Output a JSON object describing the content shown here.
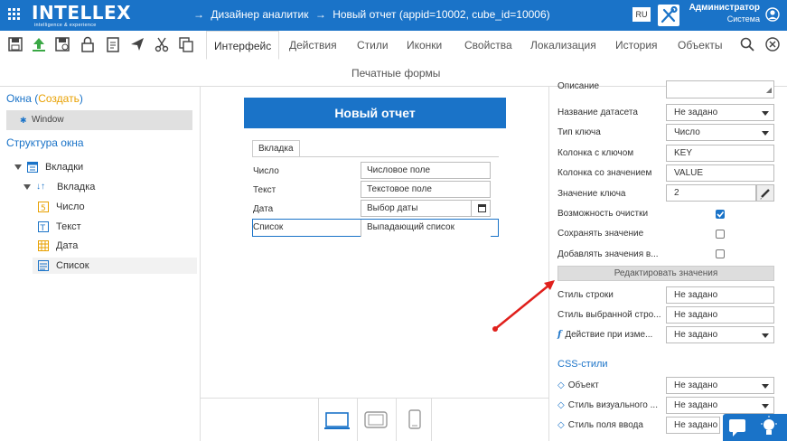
{
  "header": {
    "logo": "INTELLEX",
    "logo_sub": "intelligence & experience",
    "breadcrumb_prefix": "→",
    "breadcrumb_parent": "Дизайнер аналитик",
    "breadcrumb_sep": "→",
    "breadcrumb_current": "Новый отчет (appid=10002, cube_id=10006)",
    "lang": "RU",
    "user_name": "Администратор",
    "user_role": "Система"
  },
  "toolbar": {
    "tabs": [
      "Интерфейс",
      "Действия",
      "Стили",
      "Иконки",
      "Свойства",
      "Локализация",
      "История",
      "Объекты"
    ],
    "print_forms": "Печатные формы"
  },
  "left": {
    "windows_title": "Окна (",
    "create_label": "Создать",
    "windows_close": ")",
    "window_item": "Window",
    "structure_title": "Структура окна",
    "tree": [
      {
        "label": "Вкладки",
        "icon": "tabs-icon"
      },
      {
        "label": "Вкладка",
        "icon": "sort-arrows-icon"
      },
      {
        "label": "Число",
        "icon": "number-icon"
      },
      {
        "label": "Текст",
        "icon": "text-icon"
      },
      {
        "label": "Дата",
        "icon": "calendar-grid-icon"
      },
      {
        "label": "Список",
        "icon": "list-icon"
      }
    ]
  },
  "canvas": {
    "form_title": "Новый отчет",
    "tab_label": "Вкладка",
    "fields": [
      {
        "label": "Число",
        "value": "Числовое поле"
      },
      {
        "label": "Текст",
        "value": "Текстовое поле"
      },
      {
        "label": "Дата",
        "value": "Выбор даты"
      },
      {
        "label": "Список",
        "value": "Выпадающий список"
      }
    ]
  },
  "properties": {
    "top_label": "Описание",
    "dataset_label": "Название датасета",
    "dataset_value": "Не задано",
    "key_type_label": "Тип ключа",
    "key_type_value": "Число",
    "key_col_label": "Колонка с ключом",
    "key_col_value": "KEY",
    "val_col_label": "Колонка со значением",
    "val_col_value": "VALUE",
    "key_value_label": "Значение ключа",
    "key_value_value": "2",
    "clear_label": "Возможность очистки",
    "save_label": "Сохранять значение",
    "add_label": "Добавлять значения в...",
    "edit_values": "Редактировать значения",
    "row_style_label": "Стиль строки",
    "row_style_value": "Не задано",
    "sel_row_style_label": "Стиль выбранной стро...",
    "sel_row_style_value": "Не задано",
    "action_label": "Действие при изме...",
    "action_value": "Не задано",
    "css_title": "CSS-стили",
    "object_label": "Объект",
    "object_value": "Не задано",
    "visual_style_label": "Стиль визуального ...",
    "visual_style_value": "Не задано",
    "input_style_label": "Стиль поля ввода",
    "input_style_value": "Не задано"
  },
  "colors": {
    "accent": "#1a73c8",
    "create": "#e8a000",
    "arrow": "#e0201c"
  }
}
